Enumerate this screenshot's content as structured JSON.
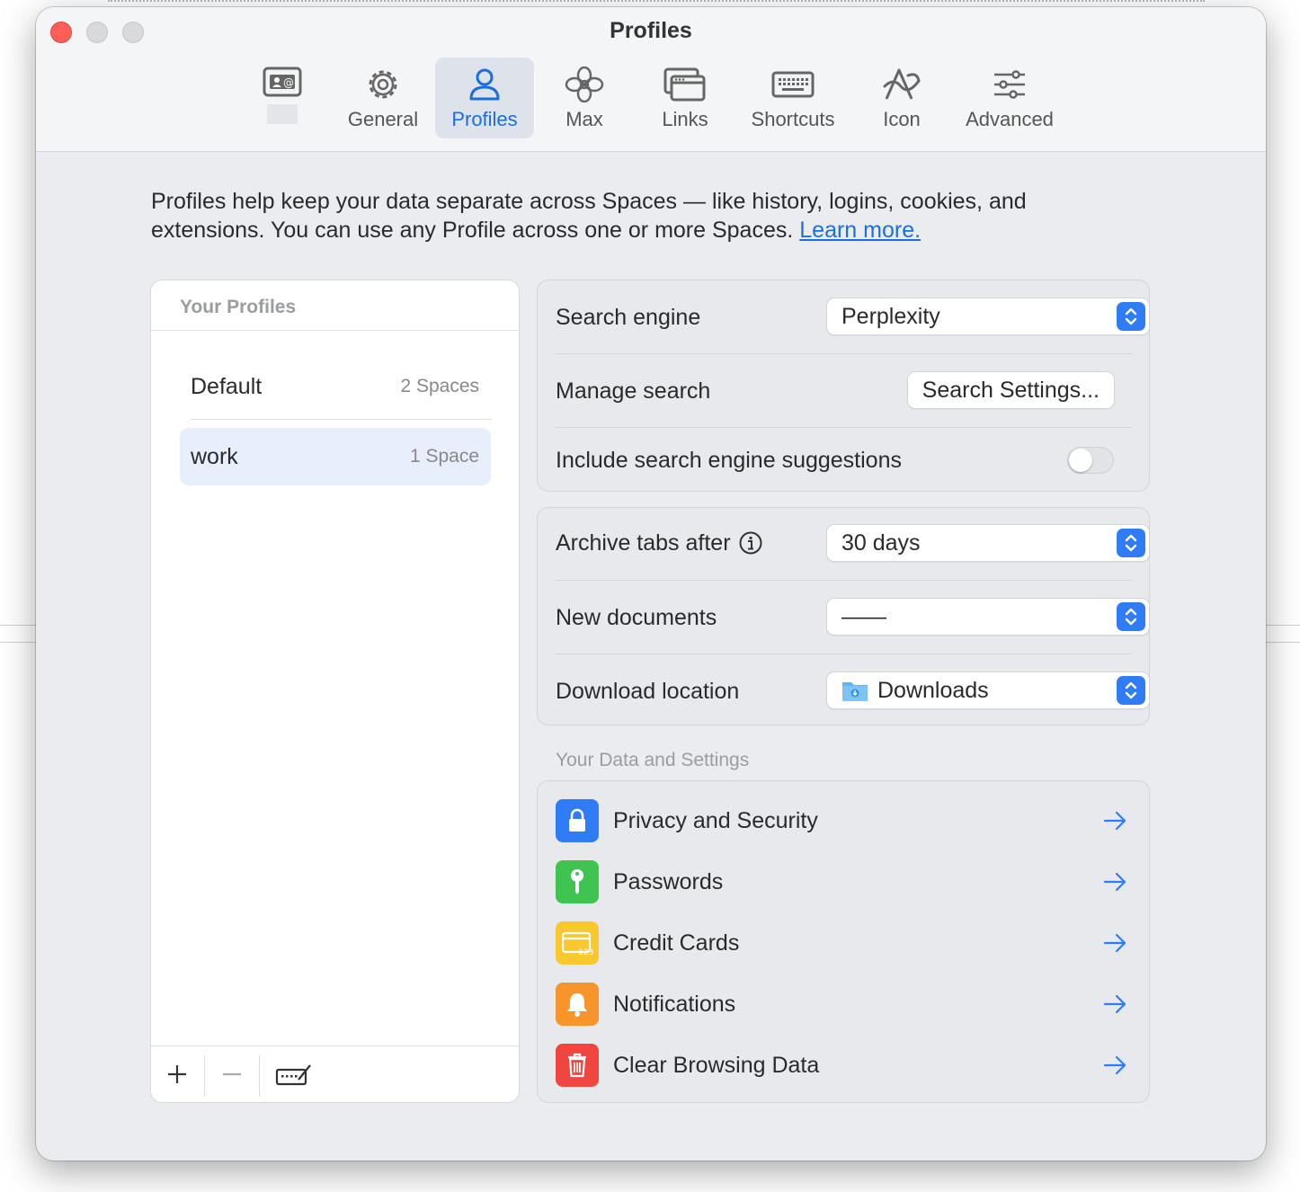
{
  "window": {
    "title": "Profiles"
  },
  "tabs": [
    {
      "label": "",
      "icon": "contact-card-icon"
    },
    {
      "label": "General",
      "icon": "gear-icon"
    },
    {
      "label": "Profiles",
      "icon": "person-icon",
      "active": true
    },
    {
      "label": "Max",
      "icon": "flower-icon"
    },
    {
      "label": "Links",
      "icon": "windows-icon"
    },
    {
      "label": "Shortcuts",
      "icon": "keyboard-icon"
    },
    {
      "label": "Icon",
      "icon": "arc-logo-icon"
    },
    {
      "label": "Advanced",
      "icon": "sliders-icon"
    }
  ],
  "intro": {
    "text": "Profiles help keep your data separate across Spaces — like history, logins, cookies, and extensions. You can use any Profile across one or more Spaces.",
    "link": "Learn more."
  },
  "profiles_panel": {
    "header": "Your Profiles",
    "items": [
      {
        "name": "Default",
        "count": "2 Spaces",
        "selected": false
      },
      {
        "name": "work",
        "count": "1 Space",
        "selected": true
      }
    ],
    "footer": {
      "add_icon": "plus-icon",
      "remove_icon": "minus-icon",
      "edit_icon": "keyboard-edit-icon"
    }
  },
  "search": {
    "engine_label": "Search engine",
    "engine_value": "Perplexity",
    "manage_label": "Manage search",
    "manage_button": "Search Settings...",
    "suggestions_label": "Include search engine suggestions",
    "suggestions_on": false
  },
  "tabs_settings": {
    "archive_label": "Archive tabs after",
    "archive_value": "30 days",
    "newdocs_label": "New documents",
    "newdocs_value": "——",
    "download_label": "Download location",
    "download_value": "Downloads"
  },
  "data_section": {
    "header": "Your Data and Settings",
    "items": [
      {
        "label": "Privacy and Security",
        "icon": "lock-icon",
        "color": "#2f7cf6"
      },
      {
        "label": "Passwords",
        "icon": "key-icon",
        "color": "#3fc351"
      },
      {
        "label": "Credit Cards",
        "icon": "credit-card-icon",
        "color": "#f9c82e"
      },
      {
        "label": "Notifications",
        "icon": "bell-icon",
        "color": "#f7952a"
      },
      {
        "label": "Clear Browsing Data",
        "icon": "trash-icon",
        "color": "#f0463f"
      }
    ]
  },
  "colors": {
    "accent": "#1a6fe0",
    "close": "#ff5f57"
  }
}
